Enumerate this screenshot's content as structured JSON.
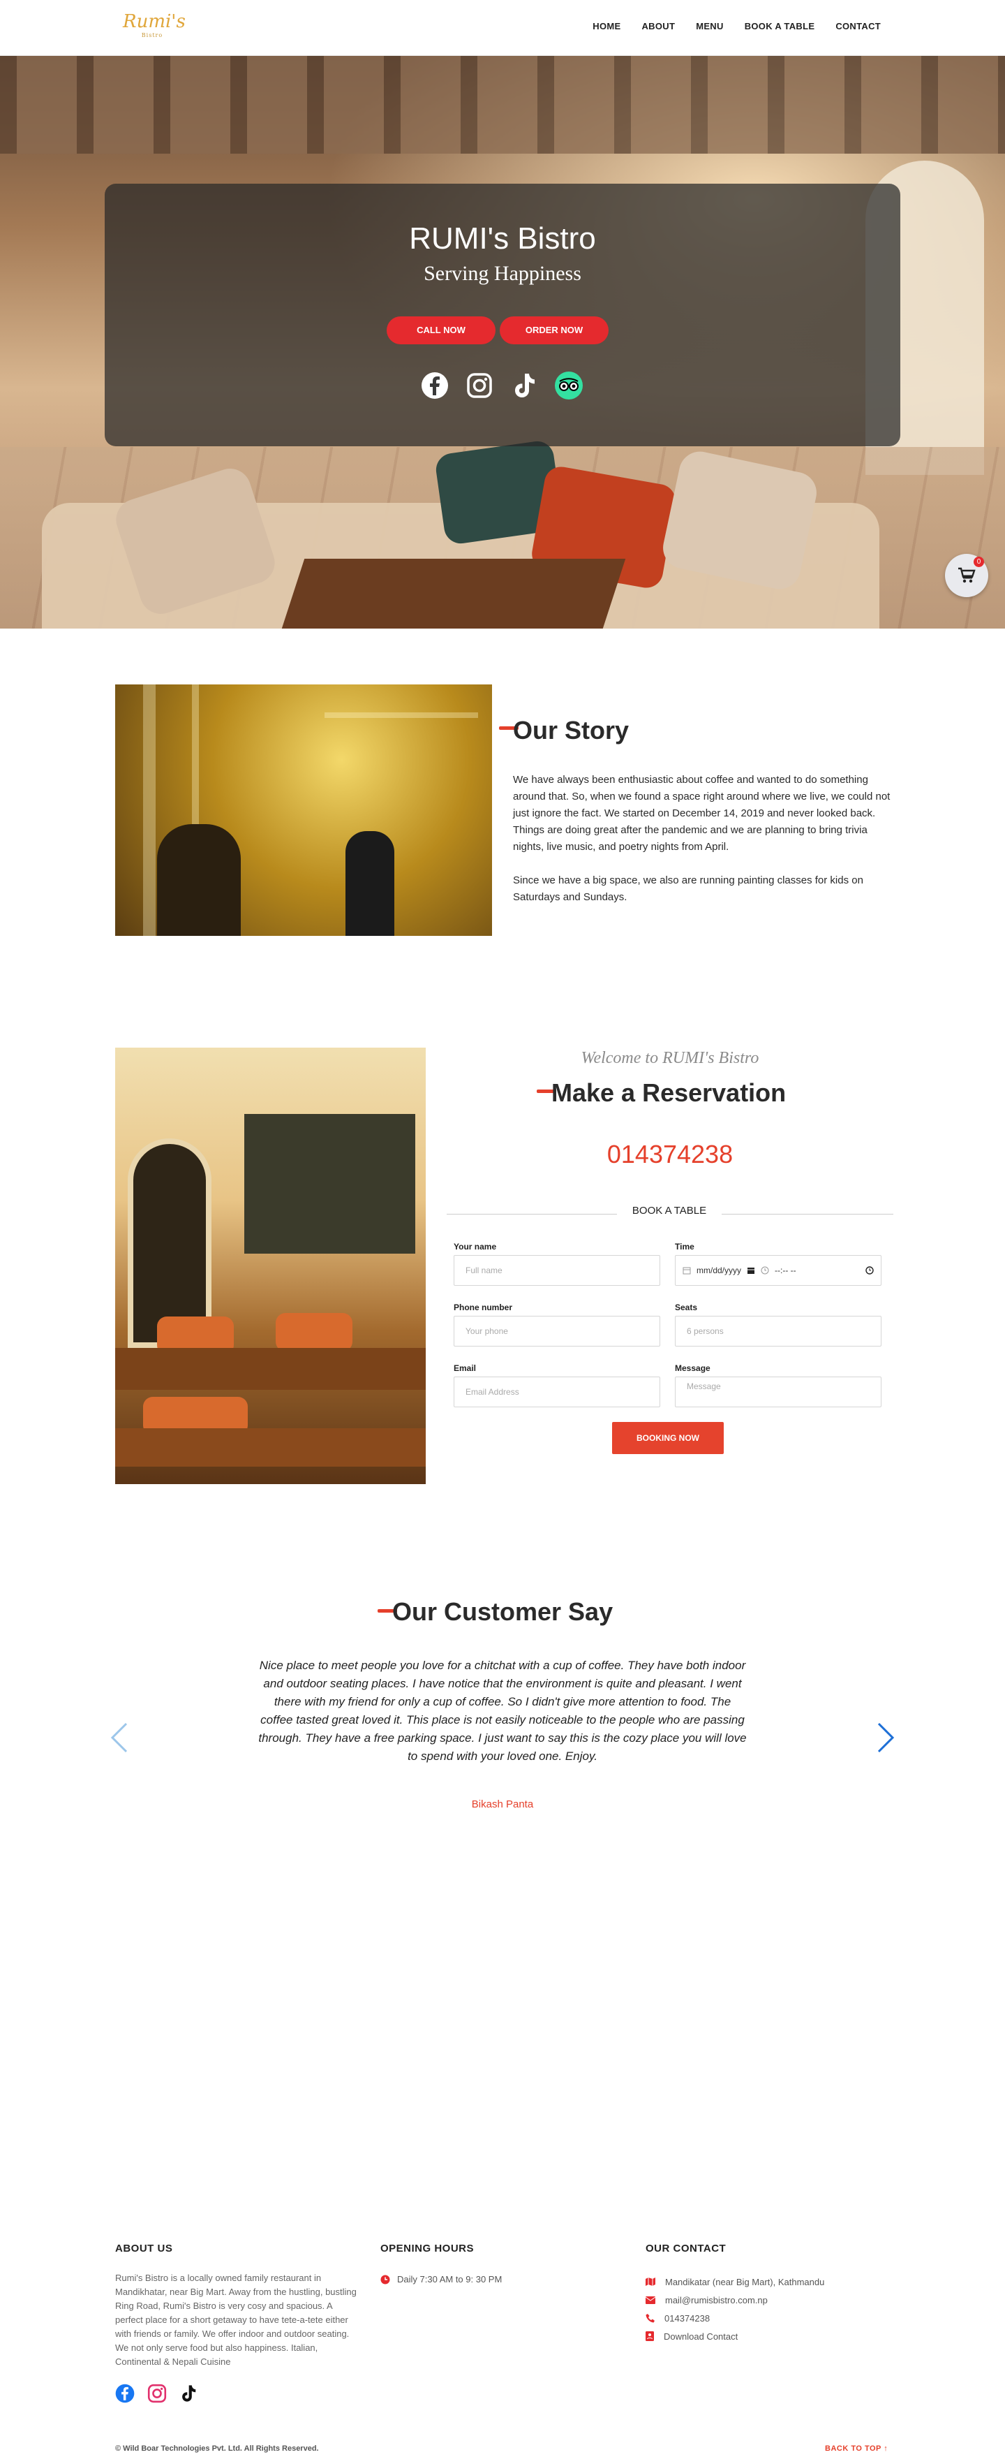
{
  "nav": {
    "logo_text": "Rumi's",
    "logo_sub": "Bistro",
    "items": [
      "HOME",
      "ABOUT",
      "MENU",
      "BOOK A TABLE",
      "CONTACT"
    ]
  },
  "hero": {
    "title": "RUMI's Bistro",
    "subtitle": "Serving Happiness",
    "call_label": "CALL NOW",
    "order_label": "ORDER NOW",
    "social_icons": [
      "facebook-icon",
      "instagram-icon",
      "tiktok-icon",
      "tripadvisor-icon"
    ],
    "cart_count": "0"
  },
  "story": {
    "title": "Our Story",
    "p1": "We have always been enthusiastic about coffee and wanted to do something around that. So, when we found a space right around where we live, we could not just ignore the fact. We started on December 14, 2019 and never looked back. Things are doing great after the pandemic and we are planning to bring trivia nights, live music, and poetry nights from April.",
    "p2": "Since we have a big space, we also are running painting classes for kids on Saturdays and Sundays."
  },
  "reservation": {
    "welcome": "Welcome to RUMI's Bistro",
    "title": "Make a Reservation",
    "phone": "014374238",
    "book_label": "BOOK A TABLE",
    "name_label": "Your name",
    "name_placeholder": "Full name",
    "time_label": "Time",
    "date_value": "mm/dd/yyyy",
    "time_value": "--:-- --",
    "phone_label": "Phone number",
    "phone_placeholder": "Your phone",
    "seats_label": "Seats",
    "seats_placeholder": "6 persons",
    "email_label": "Email",
    "email_placeholder": "Email Address",
    "message_label": "Message",
    "message_placeholder": "Message",
    "button": "BOOKING NOW"
  },
  "testimonial": {
    "title": "Our Customer Say",
    "quote": "Nice place to meet people you love for a chitchat with a cup of coffee. They have both indoor and outdoor seating places. I have notice that the environment is quite and pleasant. I went there with my friend for only a cup of coffee. So I didn't give more attention to food. The coffee tasted great loved it. This place is not easily noticeable to the people who are passing through. They have a free parking space. I just want to say this is the cozy place you will love to spend with your loved one. Enjoy.",
    "author": "Bikash Panta"
  },
  "footer": {
    "about_title": "ABOUT US",
    "about_text": "Rumi's Bistro is a locally owned family restaurant in Mandikhatar, near Big Mart. Away from the hustling, bustling Ring Road, Rumi's Bistro is very cosy and spacious. A perfect place for a short getaway to have tete-a-tete either with friends or family. We offer indoor and outdoor seating. We not only serve food but also happiness. Italian, Continental & Nepali Cuisine",
    "hours_title": "OPENING HOURS",
    "hours_text": "Daily 7:30 AM to 9: 30 PM",
    "contact_title": "OUR CONTACT",
    "address": "Mandikatar (near Big Mart), Kathmandu",
    "email": "mail@rumisbistro.com.np",
    "phone": "014374238",
    "download": "Download Contact",
    "copyright": "© Wild Boar Technologies Pvt. Ltd. All Rights Reserved.",
    "back_to_top": "BACK TO TOP ↑"
  },
  "colors": {
    "accent_red": "#e52a2e",
    "accent_orange": "#e5402b",
    "logo_gold": "#e0a63a"
  }
}
